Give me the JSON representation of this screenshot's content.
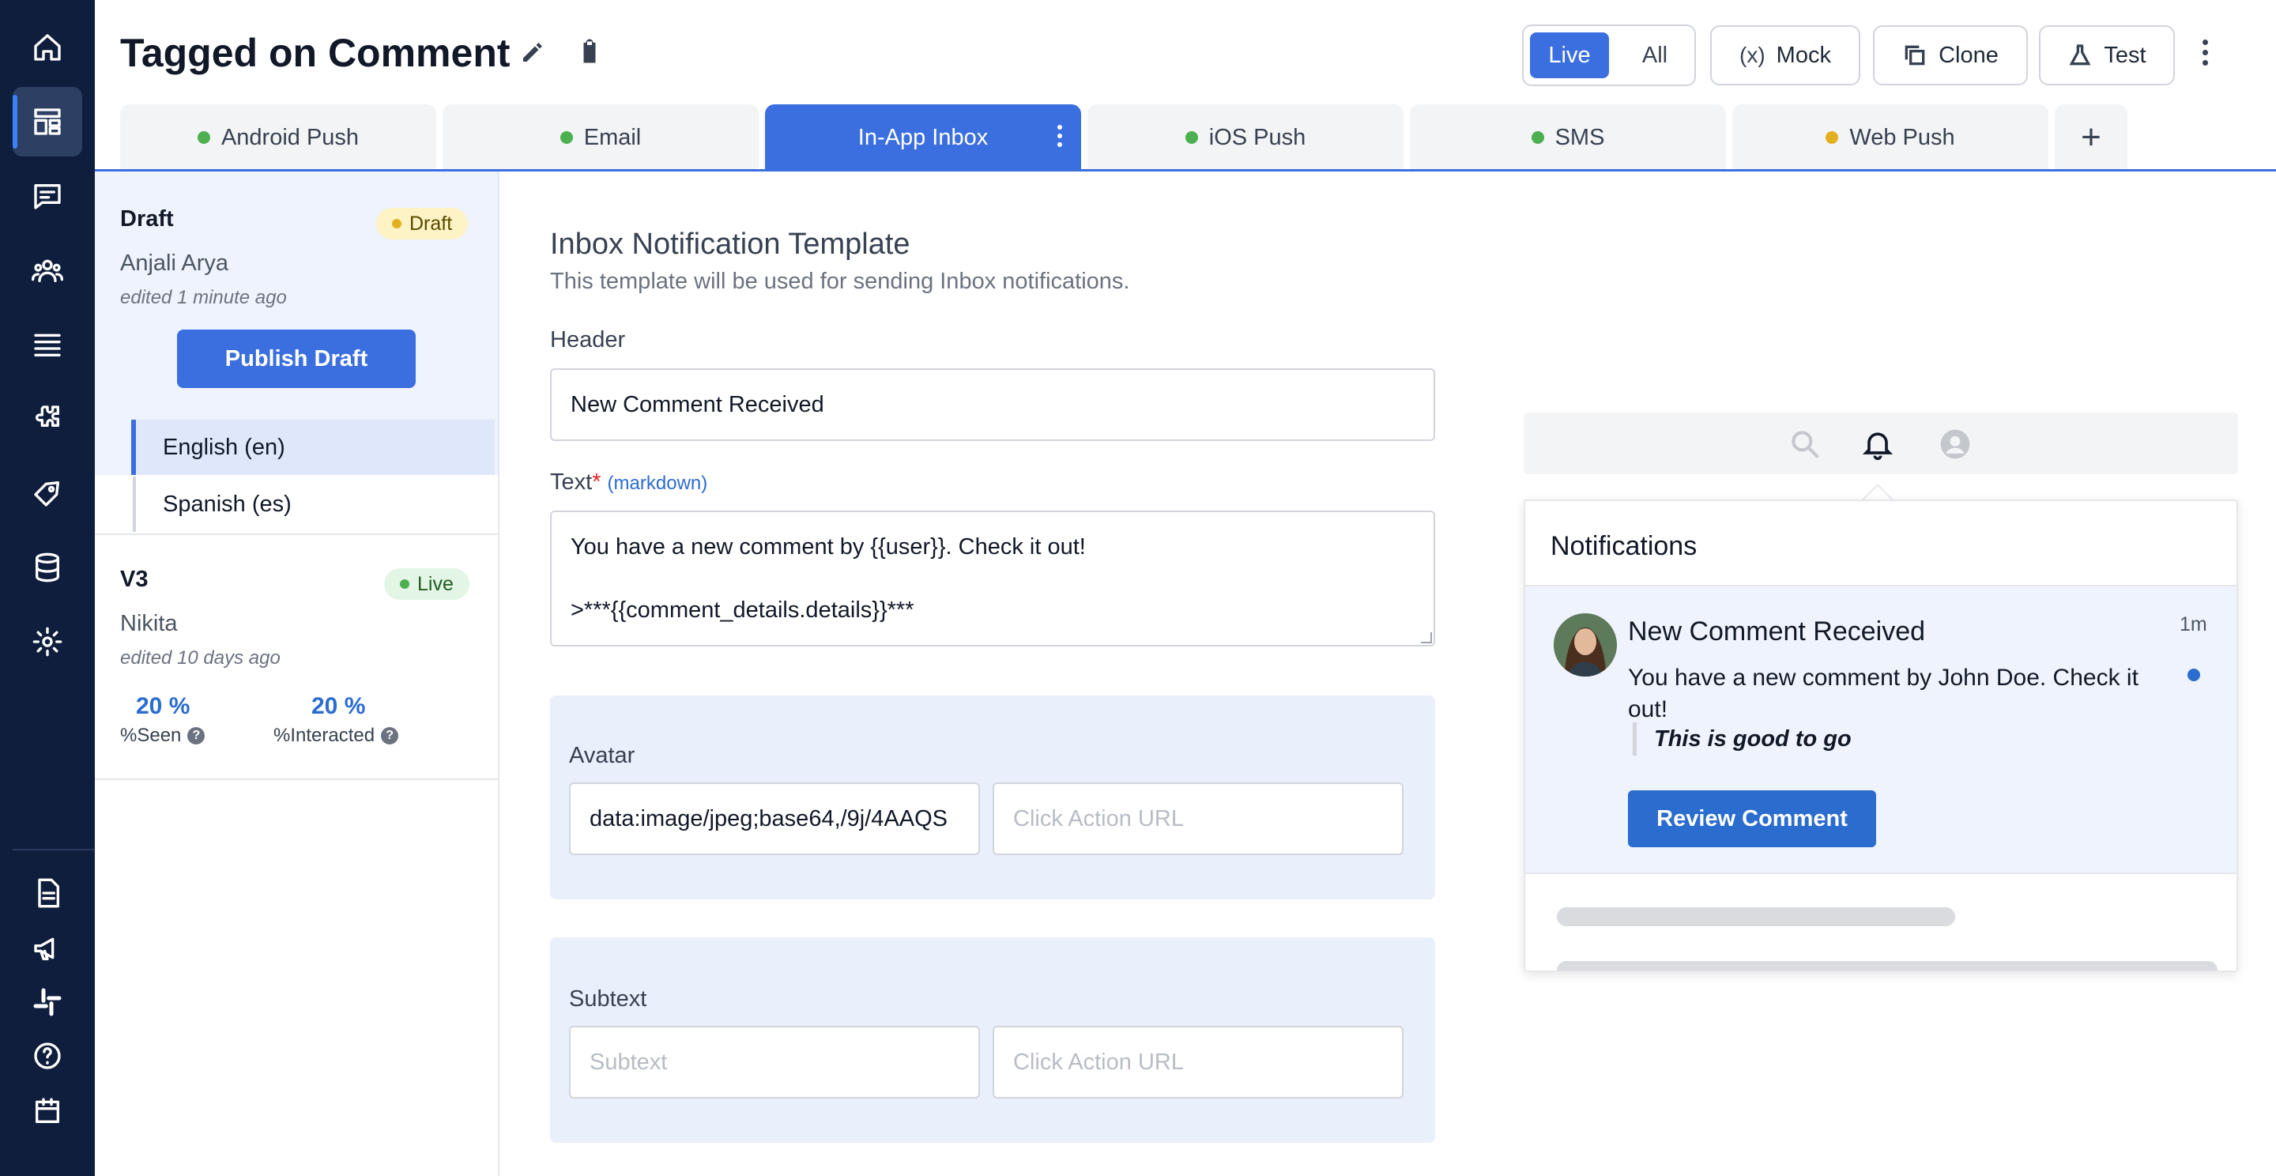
{
  "header": {
    "title": "Tagged on Comment",
    "toggle": {
      "live": "Live",
      "all": "All"
    },
    "buttons": {
      "mock": "Mock",
      "clone": "Clone",
      "test": "Test"
    }
  },
  "tabs": [
    {
      "label": "Android Push",
      "status_color": "#4caf50"
    },
    {
      "label": "Email",
      "status_color": "#4caf50"
    },
    {
      "label": "In-App Inbox",
      "status_color": ""
    },
    {
      "label": "iOS Push",
      "status_color": "#4caf50"
    },
    {
      "label": "SMS",
      "status_color": "#4caf50"
    },
    {
      "label": "Web Push",
      "status_color": "#e0b020"
    }
  ],
  "add_tab": "+",
  "versions": {
    "draft": {
      "title": "Draft",
      "badge": "Draft",
      "author": "Anjali Arya",
      "edited": "edited 1 minute ago",
      "publish_label": "Publish Draft",
      "languages": [
        "English (en)",
        "Spanish (es)"
      ]
    },
    "v3": {
      "title": "V3",
      "badge": "Live",
      "author": "Nikita",
      "edited": "edited 10 days ago",
      "seen_value": "20 %",
      "seen_label": "%Seen",
      "interacted_value": "20 %",
      "interacted_label": "%Interacted"
    }
  },
  "form": {
    "title": "Inbox Notification Template",
    "subtitle": "This template will be used for sending Inbox notifications.",
    "header_label": "Header",
    "header_value": "New Comment Received",
    "text_label": "Text",
    "text_required": "*",
    "text_markdown": "(markdown)",
    "text_value": "You have a new comment by {{user}}. Check it out!\n\n>***{{comment_details.details}}***",
    "avatar_label": "Avatar",
    "avatar_value": "data:image/jpeg;base64,/9j/4AAQS",
    "avatar_url_placeholder": "Click Action URL",
    "subtext_label": "Subtext",
    "subtext_placeholder": "Subtext",
    "subtext_url_placeholder": "Click Action URL"
  },
  "preview": {
    "heading": "Notifications",
    "notification": {
      "title": "New Comment Received",
      "time": "1m",
      "body": "You have a new comment by John Doe. Check it out!",
      "quote": "This is good to go",
      "button": "Review Comment"
    }
  },
  "colors": {
    "accent": "#3b6fe0",
    "sidebar": "#0f1e3d",
    "live": "#4caf50",
    "draft": "#e0b020"
  }
}
